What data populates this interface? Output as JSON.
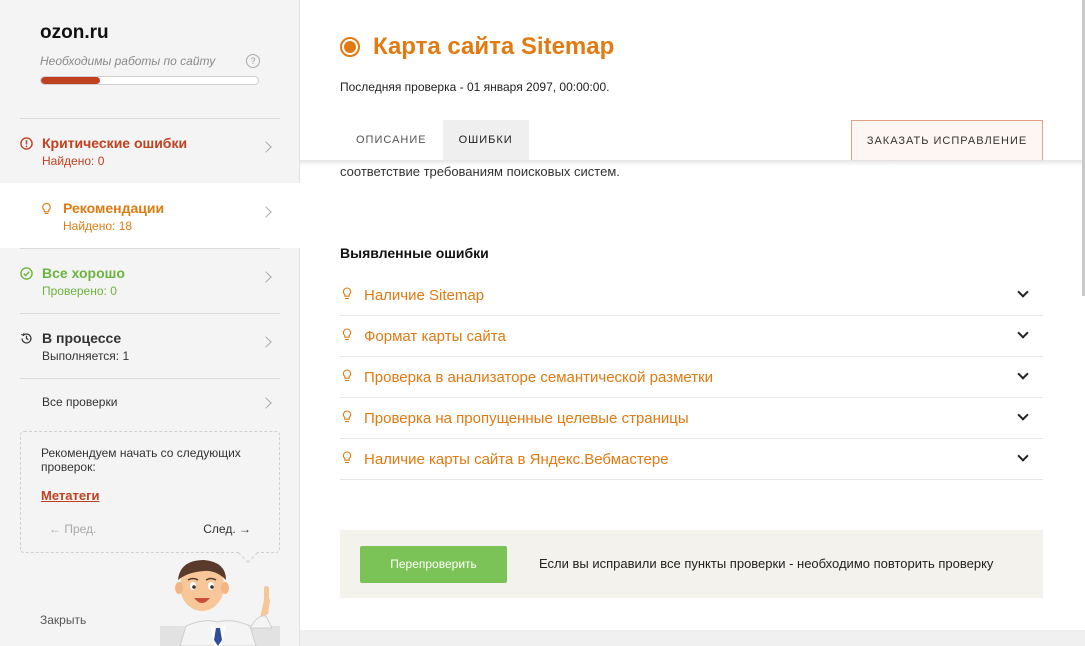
{
  "sidebar": {
    "site_name": "ozon.ru",
    "site_sub": "Необходимы работы по сайту",
    "help": "?",
    "progress_fraction": 0.27,
    "items": [
      {
        "title": "Критические ошибки",
        "sub": "Найдено: 0"
      },
      {
        "title": "Рекомендации",
        "sub": "Найдено: 18"
      },
      {
        "title": "Все хорошо",
        "sub": "Проверено: 0"
      },
      {
        "title": "В процессе",
        "sub": "Выполняется: 1"
      },
      {
        "title": "Все проверки"
      }
    ],
    "recommend": {
      "text": "Рекомендуем начать со следующих проверок:",
      "link": "Метатеги",
      "prev": "← Пред.",
      "next": "След. →"
    },
    "close": "Закрыть"
  },
  "main": {
    "title": "Карта сайта Sitemap",
    "last_check": "Последняя проверка - 01 января 2097, 00:00:00.",
    "tabs": [
      {
        "label": "Описание"
      },
      {
        "label": "Ошибки"
      }
    ],
    "order_button": "Заказать исправление",
    "description_tail": "соответствие требованиям поисковых систем.",
    "errors_heading": "Выявленные ошибки",
    "errors": [
      {
        "label": "Наличие Sitemap"
      },
      {
        "label": "Формат карты сайта"
      },
      {
        "label": "Проверка в анализаторе семантической разметки"
      },
      {
        "label": "Проверка на пропущенные целевые страницы"
      },
      {
        "label": "Наличие карты сайта в Яндекс.Вебмастере"
      }
    ],
    "recheck_button": "Перепроверить",
    "recheck_text": "Если вы исправили все пункты проверки - необходимо повторить проверку"
  },
  "colors": {
    "accent_orange": "#e27a12",
    "critical_red": "#c1401f",
    "ok_green": "#6db33f",
    "button_green": "#7cc357"
  },
  "icons": {
    "critical": "alert-circle-icon",
    "recommend": "lightbulb-icon",
    "ok": "check-circle-icon",
    "progress": "history-icon",
    "error_item": "lightbulb-icon",
    "expand": "chevron-down-icon"
  }
}
